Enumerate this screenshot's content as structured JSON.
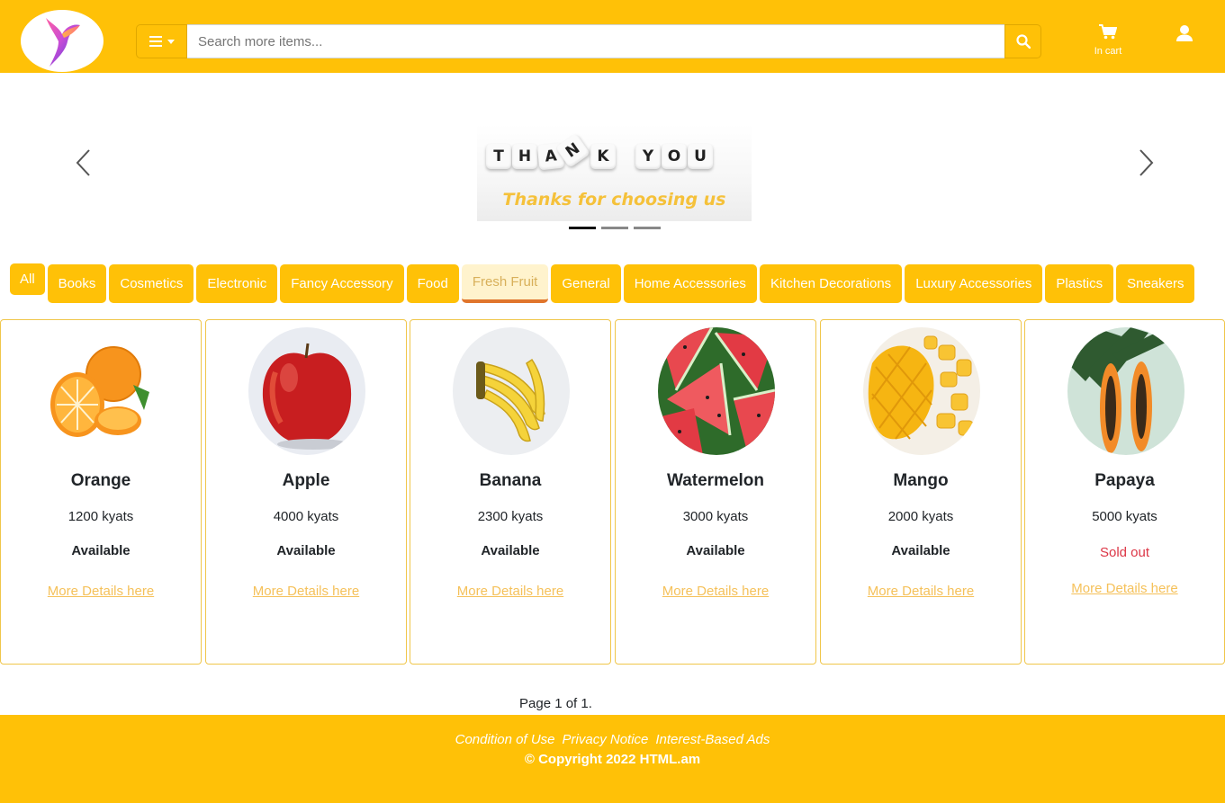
{
  "header": {
    "search_placeholder": "Search more items...",
    "cart_label": "In cart"
  },
  "banner": {
    "dice_letters": [
      "T",
      "H",
      "A",
      "N",
      "K",
      "",
      "Y",
      "O",
      "U"
    ],
    "caption": "Thanks for choosing us",
    "slides_count": 3,
    "active_slide": 1
  },
  "categories": [
    "All",
    "Books",
    "Cosmetics",
    "Electronic",
    "Fancy Accessory",
    "Food",
    "Fresh Fruit",
    "General",
    "Home Accessories",
    "Kitchen Decorations",
    "Luxury Accessories",
    "Plastics",
    "Sneakers"
  ],
  "active_category": "Fresh Fruit",
  "products": [
    {
      "name": "Orange",
      "price": "1200 kyats",
      "status": "Available",
      "link": "More Details here"
    },
    {
      "name": "Apple",
      "price": "4000 kyats",
      "status": "Available",
      "link": "More Details here"
    },
    {
      "name": "Banana",
      "price": "2300 kyats",
      "status": "Available",
      "link": "More Details here"
    },
    {
      "name": "Watermelon",
      "price": "3000 kyats",
      "status": "Available",
      "link": "More Details here"
    },
    {
      "name": "Mango",
      "price": "2000 kyats",
      "status": "Available",
      "link": "More Details here"
    },
    {
      "name": "Papaya",
      "price": "5000 kyats",
      "status": "Sold out",
      "link": "More Details here"
    }
  ],
  "pager": "Page 1 of 1.",
  "footer": {
    "links": [
      "Condition of Use",
      "Privacy Notice",
      "Interest-Based Ads"
    ],
    "copyright": "© Copyright 2022 HTML.am"
  },
  "colors": {
    "brand": "#ffc107",
    "sold_out": "#dc3545",
    "link": "#f5c15a"
  }
}
